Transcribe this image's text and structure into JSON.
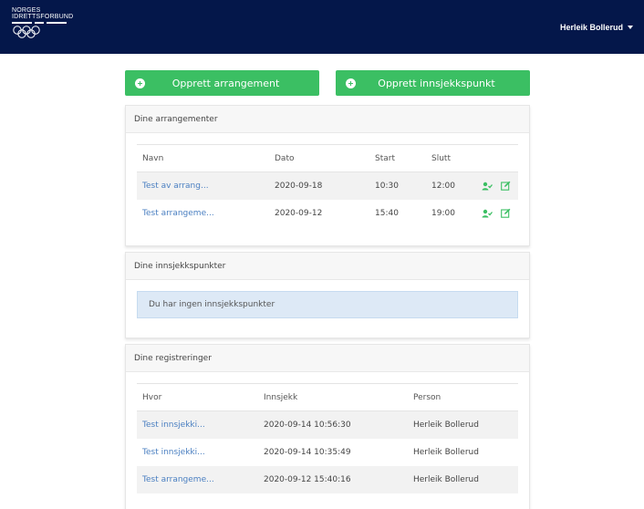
{
  "header": {
    "logo_lines": [
      "NORGES",
      "IDRETTSFORBUND"
    ],
    "user_name": "Herleik Bollerud",
    "background": "#04174a"
  },
  "actions": {
    "create_event_label": "Opprett arrangement",
    "create_checkpoint_label": "Opprett innsjekkspunkt",
    "accent": "#3bbf63"
  },
  "events": {
    "title": "Dine arrangementer",
    "columns": [
      "Navn",
      "Dato",
      "Start",
      "Slutt"
    ],
    "rows": [
      {
        "name": "Test av arrang...",
        "date": "2020-09-18",
        "start": "10:30",
        "end": "12:00"
      },
      {
        "name": "Test arrangeme...",
        "date": "2020-09-12",
        "start": "15:40",
        "end": "19:00"
      }
    ]
  },
  "checkpoints": {
    "title": "Dine innsjekkspunkter",
    "empty_message": "Du har ingen innsjekkspunkter"
  },
  "registrations": {
    "title": "Dine registreringer",
    "columns": [
      "Hvor",
      "Innsjekk",
      "Person"
    ],
    "rows": [
      {
        "where": "Test innsjekki...",
        "checkin": "2020-09-14 10:56:30",
        "person": "Herleik Bollerud"
      },
      {
        "where": "Test innsjekki...",
        "checkin": "2020-09-14 10:35:49",
        "person": "Herleik Bollerud"
      },
      {
        "where": "Test arrangeme...",
        "checkin": "2020-09-12 15:40:16",
        "person": "Herleik Bollerud"
      }
    ]
  }
}
